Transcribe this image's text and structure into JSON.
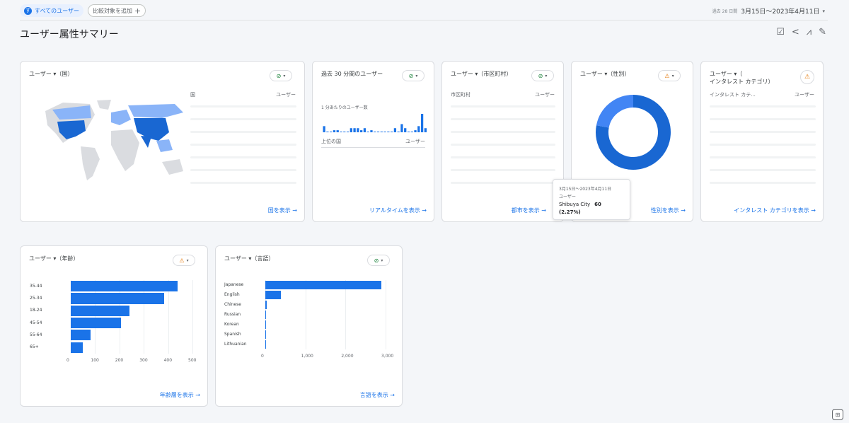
{
  "header": {
    "chip_user_icon": "す",
    "chip_user_label": "すべてのユーザー",
    "chip_add_label": "比較対象を追加",
    "chip_add_icon": "+",
    "date_prefix": "過去 28 日間",
    "date_range": "3月15日～2023年4月11日",
    "date_caret": "▾",
    "page_title": "ユーザー属性サマリー"
  },
  "actions": [
    "report-edit-icon",
    "share-icon",
    "insights-icon",
    "pencil-icon"
  ],
  "action_glyphs": [
    "☑",
    "<",
    "⩘",
    "✎"
  ],
  "cards": {
    "country": {
      "title": "ユーザー ▾（国）",
      "check": "⊘",
      "col1": "国",
      "col2": "ユーザー",
      "link": "国を表示"
    },
    "realtime": {
      "title": "過去 30 分間のユーザー",
      "check": "⊘",
      "sublabel": "1 分あたりのユーザー数",
      "col1": "上位の国",
      "col2": "ユーザー",
      "link": "リアルタイムを表示"
    },
    "city": {
      "title": "ユーザー ▾（市区町村）",
      "check": "⊘",
      "col1": "市区町村",
      "col2": "ユーザー",
      "link": "都市を表示"
    },
    "gender": {
      "title": "ユーザー ▾（性別）",
      "check": "⚠",
      "link": "性別を表示"
    },
    "interest": {
      "title_line1": "ユーザー ▾（",
      "title_line2": "インタレスト カテゴリ）",
      "warn": "⚠",
      "col1": "インタレスト カテ...",
      "col2": "ユーザー",
      "link": "インタレスト カテゴリを表示"
    },
    "age": {
      "title": "ユーザー ▾（年齢）",
      "check": "⚠",
      "link": "年齢層を表示"
    },
    "language": {
      "title": "ユーザー ▾（言語）",
      "check": "⊘",
      "link": "言語を表示"
    }
  },
  "tooltip": {
    "date": "3月15日～2023年4月11日",
    "metric": "ユーザー",
    "city": "Shibuya City",
    "value": "60 (2.27%)"
  },
  "link_arrow": "→",
  "check_caret": "▾",
  "colors": {
    "primary": "#1a73e8",
    "light": "#8ab4f8",
    "grey": "#dadce0",
    "warn": "#e37400",
    "ok": "#188038"
  },
  "chart_data": [
    {
      "type": "bar",
      "orientation": "horizontal",
      "categories": [
        "35-44",
        "25-34",
        "18-24",
        "45-54",
        "55-64",
        "65+"
      ],
      "values": [
        440,
        385,
        240,
        205,
        80,
        50
      ],
      "xlim": [
        0,
        500
      ],
      "xticks": [
        0,
        100,
        200,
        300,
        400,
        500
      ],
      "xtick_labels": [
        "0",
        "100",
        "200",
        "300",
        "400",
        "500"
      ]
    },
    {
      "type": "bar",
      "orientation": "horizontal",
      "categories": [
        "Japanese",
        "English",
        "Chinese",
        "Russian",
        "Korean",
        "Spanish",
        "Lithuanian"
      ],
      "values": [
        2900,
        390,
        30,
        15,
        10,
        5,
        3
      ],
      "xlim": [
        0,
        3000
      ],
      "xticks": [
        0,
        1000,
        2000,
        3000
      ],
      "xtick_labels": [
        "0",
        "1,000",
        "2,000",
        "3,000"
      ]
    },
    {
      "type": "pie",
      "donut": true,
      "values": [
        78,
        22
      ],
      "colors": [
        "#1967d2",
        "#4285f4"
      ]
    },
    {
      "type": "bar",
      "values": [
        3,
        0,
        0,
        1,
        1,
        0,
        0,
        0,
        2,
        2,
        2,
        1,
        2,
        0,
        1,
        0,
        0,
        0,
        0,
        0,
        0,
        2,
        0,
        4,
        2,
        0,
        0,
        1,
        3,
        9,
        2
      ]
    }
  ]
}
